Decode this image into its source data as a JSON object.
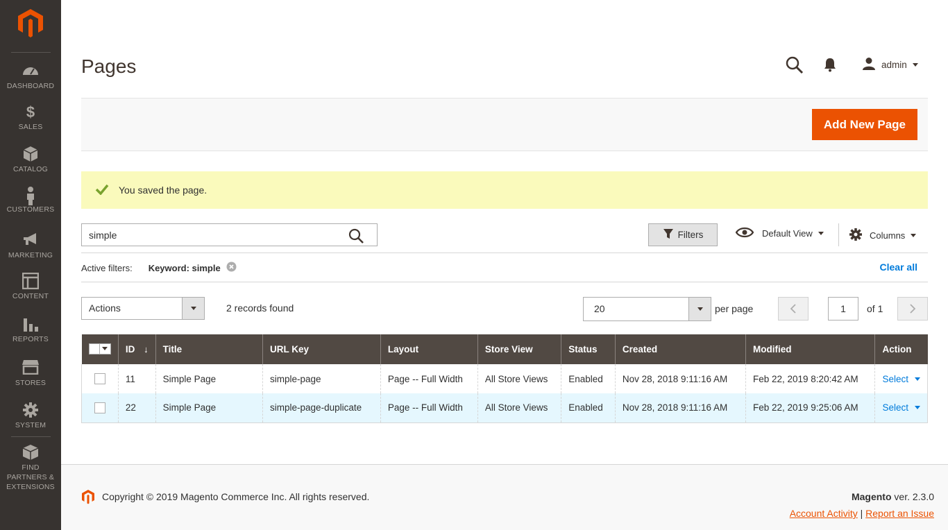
{
  "sidebar": {
    "items": [
      {
        "label": "DASHBOARD",
        "icon": "dashboard-icon"
      },
      {
        "label": "SALES",
        "icon": "dollar-icon"
      },
      {
        "label": "CATALOG",
        "icon": "cube-icon"
      },
      {
        "label": "CUSTOMERS",
        "icon": "person-icon"
      },
      {
        "label": "MARKETING",
        "icon": "megaphone-icon"
      },
      {
        "label": "CONTENT",
        "icon": "layout-icon"
      },
      {
        "label": "REPORTS",
        "icon": "bar-chart-icon"
      },
      {
        "label": "STORES",
        "icon": "storefront-icon"
      },
      {
        "label": "SYSTEM",
        "icon": "gear-icon"
      },
      {
        "label": "FIND PARTNERS & EXTENSIONS",
        "icon": "box-icon"
      }
    ]
  },
  "header": {
    "title": "Pages",
    "user": "admin"
  },
  "page_actions": {
    "add_label": "Add New Page"
  },
  "message": {
    "text": "You saved the page."
  },
  "search": {
    "value": "simple"
  },
  "toolbar": {
    "filters_label": "Filters",
    "view_label": "Default View",
    "columns_label": "Columns"
  },
  "active_filters": {
    "label": "Active filters:",
    "chip": "Keyword: simple",
    "clear_label": "Clear all"
  },
  "grid_controls": {
    "actions_label": "Actions",
    "records": "2 records found",
    "per_page_value": "20",
    "per_page_label": "per page",
    "current_page": "1",
    "of_pages": "of 1"
  },
  "table": {
    "headers": [
      "ID",
      "Title",
      "URL Key",
      "Layout",
      "Store View",
      "Status",
      "Created",
      "Modified",
      "Action"
    ],
    "rows": [
      {
        "id": "11",
        "title": "Simple Page",
        "url_key": "simple-page",
        "layout": "Page -- Full Width",
        "store_view": "All Store Views",
        "status": "Enabled",
        "created": "Nov 28, 2018 9:11:16 AM",
        "modified": "Feb 22, 2019 8:20:42 AM",
        "action": "Select"
      },
      {
        "id": "22",
        "title": "Simple Page",
        "url_key": "simple-page-duplicate",
        "layout": "Page -- Full Width",
        "store_view": "All Store Views",
        "status": "Enabled",
        "created": "Nov 28, 2018 9:11:16 AM",
        "modified": "Feb 22, 2019 9:25:06 AM",
        "action": "Select"
      }
    ]
  },
  "footer": {
    "copyright": "Copyright © 2019 Magento Commerce Inc. All rights reserved.",
    "brand": "Magento",
    "version": " ver. 2.3.0",
    "account_activity": "Account Activity",
    "separator": " | ",
    "report_issue": "Report an Issue"
  },
  "colors": {
    "sidebar_bg": "#373330",
    "accent": "#eb5202",
    "link": "#007bdb",
    "table_header_bg": "#514943",
    "message_bg": "#fafabc",
    "selected_row_bg": "#e5f7fe"
  }
}
